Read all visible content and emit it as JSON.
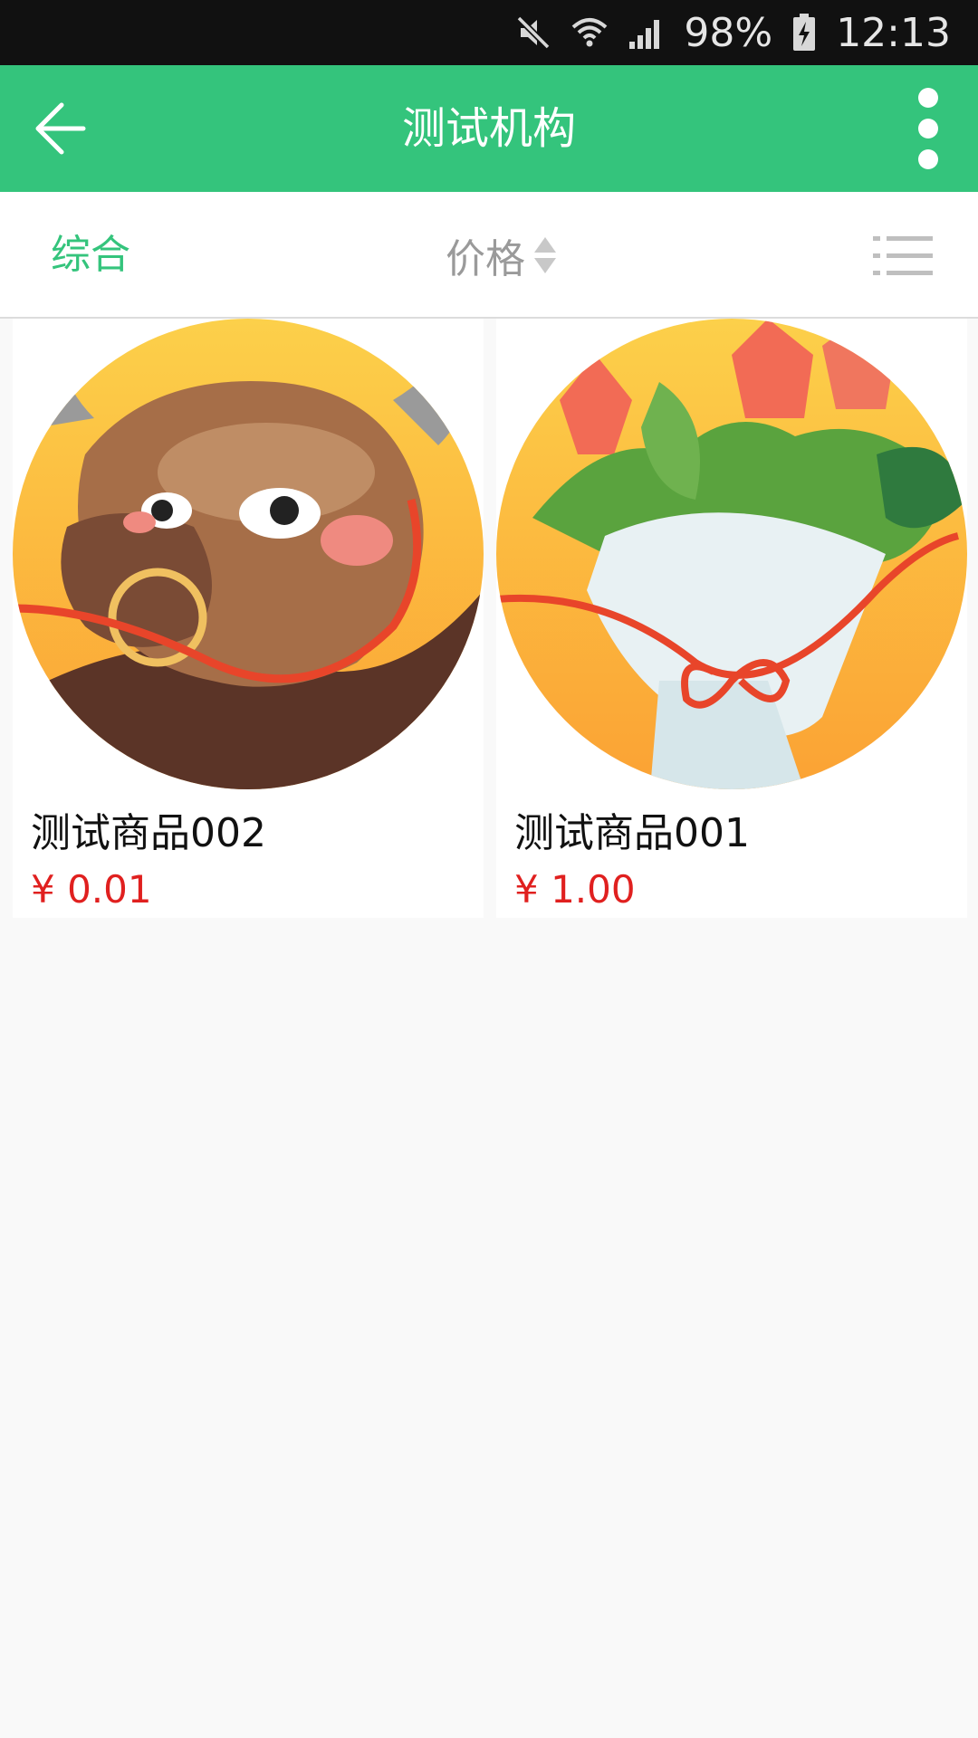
{
  "status_bar": {
    "battery": "98%",
    "time": "12:13",
    "icons": [
      "mute-icon",
      "wifi-icon",
      "signal-icon",
      "battery-charging-icon"
    ]
  },
  "app_bar": {
    "title": "测试机构",
    "back_icon": "arrow-left-icon",
    "menu_icon": "more-vertical-icon",
    "background": "#34c47c"
  },
  "filter_bar": {
    "comprehensive_label": "综合",
    "price_label": "价格",
    "sort_icon": "sort-updown-icon",
    "view_toggle_icon": "list-view-icon",
    "active_color": "#34c47c",
    "inactive_color": "#9a9a9a"
  },
  "products": [
    {
      "name": "测试商品002",
      "price": "¥ 0.01",
      "image": "bull-illustration"
    },
    {
      "name": "测试商品001",
      "price": "¥ 1.00",
      "image": "bouquet-illustration"
    }
  ],
  "colors": {
    "price": "#e0201f",
    "page_background": "#f9f9f9"
  }
}
